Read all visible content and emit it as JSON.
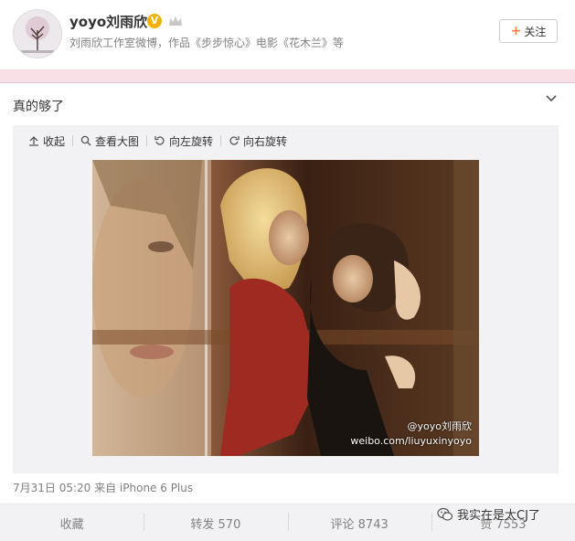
{
  "profile": {
    "username": "yoyo刘雨欣",
    "verified_mark": "V",
    "description": "刘雨欣工作室微博，作品《步步惊心》电影《花木兰》等",
    "follow_label": "关注",
    "avatar_icon": "tree-avatar-icon",
    "crown_icon": "crown-icon"
  },
  "post": {
    "text": "真的够了",
    "meta": "7月31日 05:20 来自 iPhone 6 Plus"
  },
  "toolbar": {
    "collapse": "收起",
    "view_large": "查看大图",
    "rotate_left": "向左旋转",
    "rotate_right": "向右旋转"
  },
  "photo": {
    "watermark_handle": "@yoyo刘雨欣",
    "watermark_url": "weibo.com/liuyuxinyoyo"
  },
  "actions": {
    "favorite": "收藏",
    "repost": "转发 570",
    "comment": "评论 8743",
    "like": "赞 7553"
  },
  "overlay": {
    "wechat_watermark": "我实在是太CJ了"
  },
  "colors": {
    "pink_bar": "#f9e0e7",
    "panel_bg": "#f2f2f5",
    "badge": "#f2b100",
    "follow_plus": "#ff8140"
  }
}
